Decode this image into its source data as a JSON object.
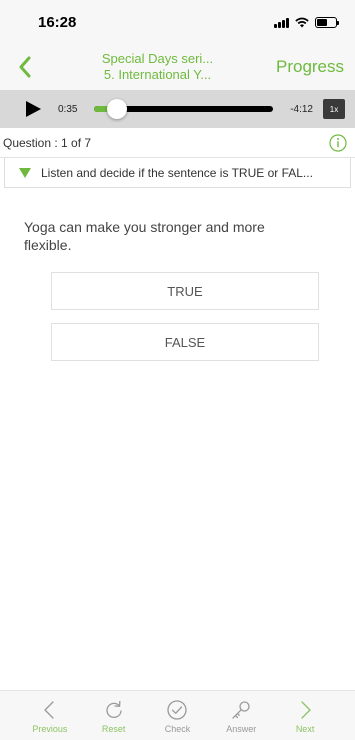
{
  "status_bar": {
    "time": "16:28"
  },
  "nav": {
    "title_line1": "Special Days seri...",
    "title_line2": "5. International Y...",
    "progress_label": "Progress"
  },
  "audio": {
    "current_time": "0:35",
    "remaining_time": "-4:12",
    "speed_label": "1x",
    "progress_fraction": 0.13
  },
  "question": {
    "counter": "Question : 1 of 7",
    "instruction": "Listen and decide if the sentence is TRUE or FAL...",
    "text": "Yoga can make you stronger and more flexible.",
    "options": [
      "TRUE",
      "FALSE"
    ]
  },
  "toolbar": {
    "items": [
      {
        "label": "Previous",
        "icon": "chevron-left-icon",
        "active": true
      },
      {
        "label": "Reset",
        "icon": "reset-icon",
        "active": true
      },
      {
        "label": "Check",
        "icon": "check-circle-icon",
        "active": false
      },
      {
        "label": "Answer",
        "icon": "key-icon",
        "active": false
      },
      {
        "label": "Next",
        "icon": "chevron-right-icon",
        "active": true
      }
    ]
  },
  "colors": {
    "accent": "#6fba3e",
    "audio_bar_bg": "#d8d8d8",
    "inactive": "#999999"
  }
}
